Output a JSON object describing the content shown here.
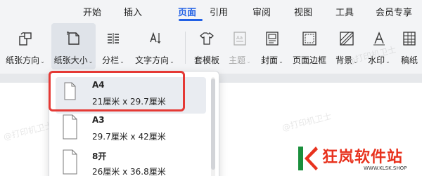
{
  "tabs": [
    {
      "label": "开始",
      "active": false
    },
    {
      "label": "插入",
      "active": false
    },
    {
      "label": "页面",
      "active": true
    },
    {
      "label": "引用",
      "active": false
    },
    {
      "label": "审阅",
      "active": false
    },
    {
      "label": "视图",
      "active": false
    },
    {
      "label": "工具",
      "active": false
    },
    {
      "label": "会员专享",
      "active": false
    }
  ],
  "ribbon": {
    "paper_direction": "纸张方向",
    "paper_size": "纸张大小",
    "columns": "分栏",
    "text_direction": "文字方向",
    "template": "套模板",
    "theme": "主题",
    "cover": "封面",
    "page_border": "页面边框",
    "background": "背景",
    "watermark": "水印",
    "manuscript": "稿纸"
  },
  "paper_sizes": [
    {
      "name": "A4",
      "size": "21厘米  x  29.7厘米",
      "selected": true
    },
    {
      "name": "A3",
      "size": "29.7厘米  x  42厘米",
      "selected": false
    },
    {
      "name": "8开",
      "size": "26厘米  x  36.8厘米",
      "selected": false
    }
  ],
  "watermark_text": "@打印机卫士",
  "logo": {
    "brand": "狂岚软件站",
    "url": "WWW.KLSK.SHOP"
  },
  "colors": {
    "accent": "#2160e5",
    "highlight": "#e53935",
    "logo_red": "#e8321e"
  }
}
